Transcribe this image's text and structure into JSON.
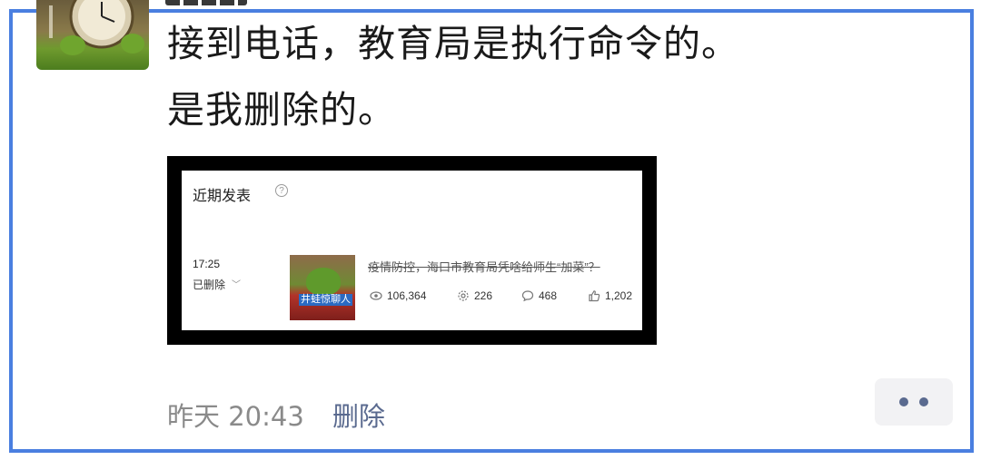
{
  "moment": {
    "text_line_1": "接到电话，教育局是执行命令的。",
    "text_line_2": "是我删除的。",
    "embedded_screenshot": {
      "section_title": "近期发表",
      "help_icon": "question-circle-icon",
      "time": "17:25",
      "status": "已删除",
      "status_icon": "chevron-down-icon",
      "article_title": "疫情防控，海口市教育局凭啥给师生“加菜”？",
      "thumbnail_caption": "井蛙惊聊人",
      "stats": {
        "views": "106,364",
        "shares": "226",
        "comments": "468",
        "likes": "1,202"
      }
    },
    "timestamp": "昨天 20:43",
    "delete_label": "删除",
    "more_icon": "more-dots-icon"
  },
  "colors": {
    "frame_border": "#4a7fe0",
    "link": "#5a6a8f",
    "meta_text": "#8a8a8a"
  }
}
